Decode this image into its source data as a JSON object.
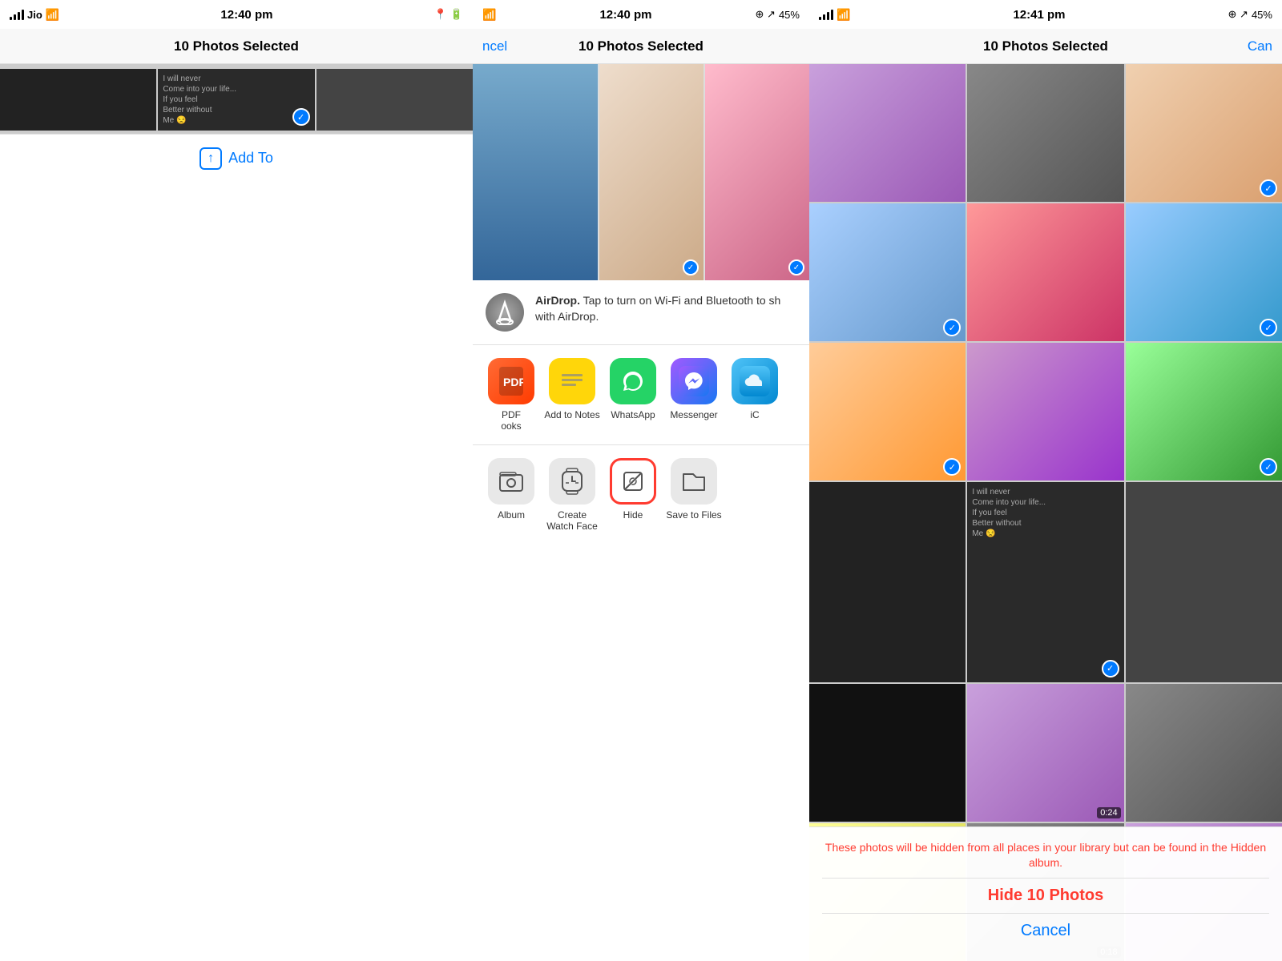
{
  "panels": {
    "left": {
      "status": {
        "carrier": "Jio",
        "time": "12:40 pm",
        "battery": "●●●"
      },
      "title": "10 Photos Selected",
      "add_to_label": "Add To",
      "photos": [
        {
          "id": 1,
          "color": "cell-color-1",
          "checked": false
        },
        {
          "id": 2,
          "color": "cell-color-2",
          "checked": false
        },
        {
          "id": 3,
          "color": "cell-color-3",
          "checked": true
        },
        {
          "id": 4,
          "color": "cell-color-4",
          "checked": true
        },
        {
          "id": 5,
          "color": "cell-color-5",
          "checked": false
        },
        {
          "id": 6,
          "color": "cell-color-6",
          "checked": true
        },
        {
          "id": 7,
          "color": "cell-color-7",
          "checked": true
        },
        {
          "id": 8,
          "color": "cell-color-8",
          "checked": false
        },
        {
          "id": 9,
          "color": "cell-color-9",
          "checked": true
        },
        {
          "id": 10,
          "color": "cell-color-dark",
          "checked": false
        },
        {
          "id": 11,
          "color": "cell-color-text2",
          "checked": false
        },
        {
          "id": 12,
          "color": "cell-color-text1",
          "checked": false
        },
        {
          "id": 13,
          "color": "cell-color-night",
          "checked": false
        },
        {
          "id": 14,
          "color": "cell-color-selfie",
          "checked": false,
          "duration": "0:24"
        },
        {
          "id": 15,
          "color": "cell-color-2",
          "checked": false
        },
        {
          "id": 16,
          "color": "cell-color-10",
          "checked": false,
          "duration": "0:18"
        },
        {
          "id": 17,
          "color": "cell-color-selfie",
          "checked": false
        },
        {
          "id": 18,
          "color": "cell-color-1",
          "checked": false
        }
      ]
    },
    "middle": {
      "status": {
        "cancel": "ncel",
        "time": "12:40 pm",
        "battery": "45%"
      },
      "title": "10 Photos Selected",
      "airdrop": {
        "text_bold": "AirDrop.",
        "text": "Tap to turn on Wi-Fi and Bluetooth to sh with AirDrop."
      },
      "apps": [
        {
          "id": "pdf",
          "label": "PDF\nooks",
          "icon_char": "📄",
          "bg": "pdf"
        },
        {
          "id": "notes",
          "label": "Add to Notes",
          "icon_char": "📝",
          "bg": "notes"
        },
        {
          "id": "whatsapp",
          "label": "WhatsApp",
          "icon_char": "✆",
          "bg": "whatsapp"
        },
        {
          "id": "messenger",
          "label": "Messenger",
          "icon_char": "💬",
          "bg": "messenger"
        },
        {
          "id": "icloud",
          "label": "iC",
          "icon_char": "☁",
          "bg": "icloud"
        }
      ],
      "actions": [
        {
          "id": "album",
          "label": "Album",
          "icon_char": "🗂"
        },
        {
          "id": "watch",
          "label": "Create\nWatch Face",
          "icon_char": "⌚"
        },
        {
          "id": "hide",
          "label": "Hide",
          "icon_char": "🚫",
          "highlight": true
        },
        {
          "id": "save",
          "label": "Save to Files",
          "icon_char": "📁"
        }
      ]
    },
    "right": {
      "status": {
        "time": "12:41 pm",
        "battery": "45%",
        "cancel": "Can"
      },
      "title": "10 Photos Selected",
      "hide_alert": {
        "text": "These photos will be hidden from all places in your library but can be found in the Hidden album.",
        "button": "Hide 10 Photos",
        "cancel": "Cancel"
      }
    }
  }
}
